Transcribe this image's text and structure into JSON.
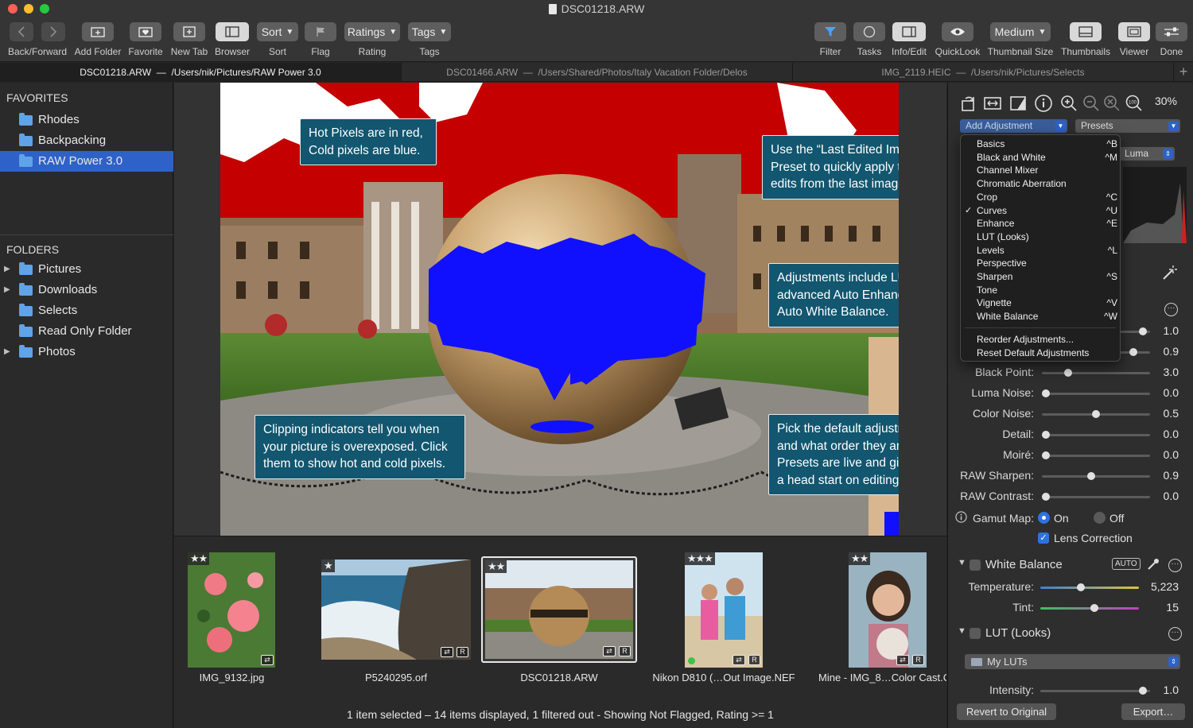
{
  "window": {
    "title": "DSC01218.ARW"
  },
  "toolbar": {
    "back_forward": "Back/Forward",
    "add_folder": "Add Folder",
    "favorite": "Favorite",
    "new_tab": "New Tab",
    "browser": "Browser",
    "sort_button": "Sort",
    "sort_label": "Sort",
    "flag": "Flag",
    "ratings_button": "Ratings",
    "rating_label": "Rating",
    "tags_button": "Tags",
    "tags_label": "Tags",
    "filter": "Filter",
    "tasks": "Tasks",
    "info_edit": "Info/Edit",
    "quicklook": "QuickLook",
    "thumb_size_button": "Medium",
    "thumb_size_label": "Thumbnail Size",
    "thumbnails": "Thumbnails",
    "viewer": "Viewer",
    "done": "Done"
  },
  "tabs": [
    {
      "name": "DSC01218.ARW",
      "path": "/Users/nik/Pictures/RAW Power 3.0",
      "sep": "—"
    },
    {
      "name": "DSC01466.ARW",
      "path": "/Users/Shared/Photos/Italy Vacation Folder/Delos",
      "sep": "—"
    },
    {
      "name": "IMG_2119.HEIC",
      "path": "/Users/nik/Pictures/Selects",
      "sep": "—"
    }
  ],
  "sidebar": {
    "favorites_heading": "FAVORITES",
    "favorites": [
      {
        "label": "Rhodes"
      },
      {
        "label": "Backpacking"
      },
      {
        "label": "RAW Power 3.0"
      }
    ],
    "folders_heading": "FOLDERS",
    "folders": [
      {
        "label": "Pictures"
      },
      {
        "label": "Downloads"
      },
      {
        "label": "Selects"
      },
      {
        "label": "Read Only Folder"
      },
      {
        "label": "Photos"
      }
    ]
  },
  "callouts": {
    "hot_pixels": "Hot Pixels are in red, Cold pixels are blue.",
    "last_edited": "Use the “Last Edited Image” Preset to quickly apply the edits from the last image.",
    "adjustments": "Adjustments include LUTs, advanced Auto Enhance and Auto White Balance.",
    "clipping": "Clipping indicators tell you when your picture is overexposed. Click them to show hot and cold pixels.",
    "pick_default": "Pick the default adjustments and what order they are in. Presets are live and give you a head start on editing."
  },
  "filmstrip": {
    "items": [
      {
        "name": "IMG_9132.jpg",
        "stars": "★★"
      },
      {
        "name": "P5240295.orf",
        "stars": "★"
      },
      {
        "name": "DSC01218.ARW",
        "stars": "★★"
      },
      {
        "name": "Nikon D810 (…Out Image.NEF",
        "stars": "★★★"
      },
      {
        "name": "Mine - IMG_8…Color Cast.C",
        "stars": "★★"
      }
    ],
    "status": "1 item selected – 14 items displayed, 1 filtered out - Showing Not Flagged, Rating >= 1"
  },
  "panel": {
    "zoom": "30%",
    "add_adjustment": "Add Adjustment",
    "presets": "Presets",
    "luma": "Luma",
    "sliders": [
      {
        "label": "",
        "value": "1.0",
        "pos": 0.97
      },
      {
        "label": "",
        "value": "0.9",
        "pos": 0.87
      },
      {
        "label": "Black Point:",
        "value": "3.0",
        "pos": 0.22
      },
      {
        "label": "Luma Noise:",
        "value": "0.0",
        "pos": 0.0
      },
      {
        "label": "Color Noise:",
        "value": "0.5",
        "pos": 0.5
      },
      {
        "label": "Detail:",
        "value": "0.0",
        "pos": 0.0
      },
      {
        "label": "Moiré:",
        "value": "0.0",
        "pos": 0.0
      },
      {
        "label": "RAW Sharpen:",
        "value": "0.9",
        "pos": 0.45
      },
      {
        "label": "RAW Contrast:",
        "value": "0.0",
        "pos": 0.0
      }
    ],
    "gamut_map": "Gamut Map:",
    "gamut_on": "On",
    "gamut_off": "Off",
    "lens_correction": "Lens Correction",
    "white_balance": "White Balance",
    "auto": "AUTO",
    "temperature_label": "Temperature:",
    "temperature_value": "5,223",
    "temperature_pos": 0.4,
    "tint_label": "Tint:",
    "tint_value": "15",
    "tint_pos": 0.55,
    "lut_section": "LUT (Looks)",
    "my_luts": "My LUTs",
    "intensity_label": "Intensity:",
    "intensity_value": "1.0",
    "intensity_pos": 0.97,
    "revert": "Revert to Original",
    "export": "Export…"
  },
  "menu": {
    "items": [
      {
        "label": "Basics",
        "shortcut": "^B",
        "checked": false
      },
      {
        "label": "Black and White",
        "shortcut": "^M",
        "checked": false
      },
      {
        "label": "Channel Mixer",
        "shortcut": "",
        "checked": false
      },
      {
        "label": "Chromatic Aberration",
        "shortcut": "",
        "checked": false
      },
      {
        "label": "Crop",
        "shortcut": "^C",
        "checked": false
      },
      {
        "label": "Curves",
        "shortcut": "^U",
        "checked": true
      },
      {
        "label": "Enhance",
        "shortcut": "^E",
        "checked": false
      },
      {
        "label": "LUT (Looks)",
        "shortcut": "",
        "checked": false
      },
      {
        "label": "Levels",
        "shortcut": "^L",
        "checked": false
      },
      {
        "label": "Perspective",
        "shortcut": "",
        "checked": false
      },
      {
        "label": "Sharpen",
        "shortcut": "^S",
        "checked": false
      },
      {
        "label": "Tone",
        "shortcut": "",
        "checked": false
      },
      {
        "label": "Vignette",
        "shortcut": "^V",
        "checked": false
      },
      {
        "label": "White Balance",
        "shortcut": "^W",
        "checked": false
      }
    ],
    "extra": [
      {
        "label": "Reorder Adjustments..."
      },
      {
        "label": "Reset Default Adjustments"
      }
    ]
  },
  "colors": {
    "accent": "#2e62c8",
    "callout_bg": "#12566f",
    "hot_pixel": "#c40000",
    "cold_pixel": "#1010ff"
  }
}
